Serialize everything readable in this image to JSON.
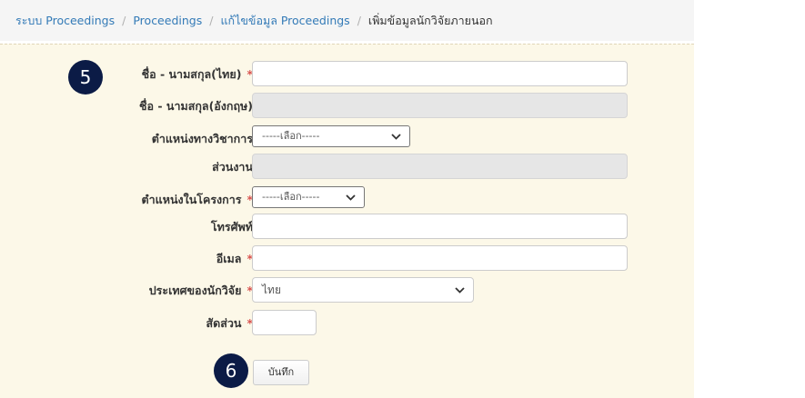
{
  "breadcrumb": {
    "items": [
      "ระบบ Proceedings",
      "Proceedings",
      "แก้ไขข้อมูล Proceedings"
    ],
    "current": "เพิ่มข้อมูลนักวิจัยภายนอก",
    "separator": "/"
  },
  "badges": {
    "step5": "5",
    "step6": "6"
  },
  "form": {
    "required_mark": "*",
    "name_th": {
      "label": "ชื่อ - นามสกุล(ไทย)",
      "value": ""
    },
    "name_en": {
      "label": "ชื่อ - นามสกุล(อังกฤษ)",
      "value": ""
    },
    "academic_position": {
      "label": "ตำแหน่งทางวิชาการ",
      "selected": "-----เลือก-----"
    },
    "department": {
      "label": "ส่วนงาน",
      "value": ""
    },
    "project_position": {
      "label": "ตำแหน่งในโครงการ",
      "selected": "-----เลือก-----"
    },
    "phone": {
      "label": "โทรศัพท์",
      "value": ""
    },
    "email": {
      "label": "อีเมล",
      "value": ""
    },
    "country": {
      "label": "ประเทศของนักวิจัย",
      "selected": "ไทย"
    },
    "ratio": {
      "label": "สัดส่วน",
      "value": ""
    },
    "save_label": "บันทึก"
  },
  "colors": {
    "link": "#337ab7",
    "required": "#d9534f",
    "panel": "#fcf8e8",
    "badge": "#0b1b46"
  },
  "icons": {
    "dropdown": "chevron-down-icon"
  }
}
